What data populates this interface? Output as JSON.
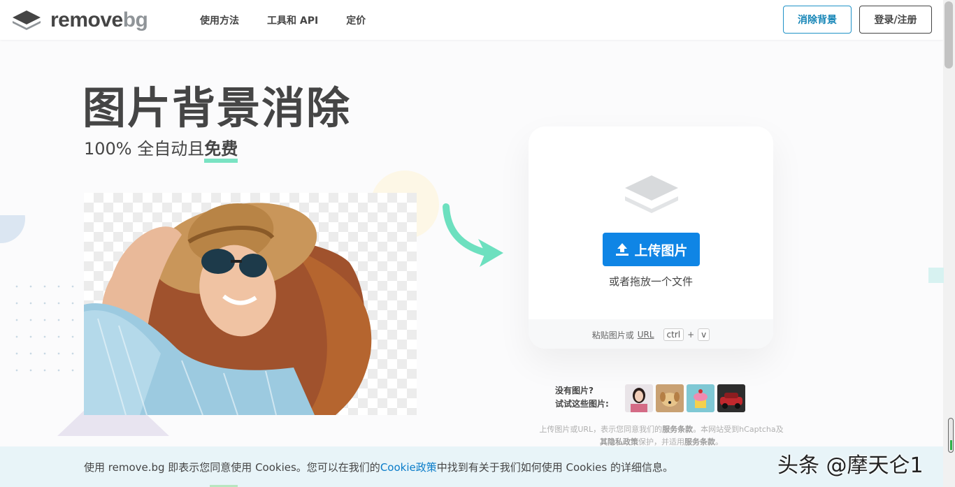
{
  "header": {
    "logo_primary": "remove",
    "logo_secondary": "bg",
    "nav": [
      "使用方法",
      "工具和 API",
      "定价"
    ],
    "remove_bg_button": "消除背景",
    "login_button": "登录/注册"
  },
  "hero": {
    "title": "图片背景消除",
    "subtitle_prefix": "100% 全自动且",
    "subtitle_highlight": "免费"
  },
  "upload_card": {
    "upload_button": "上传图片",
    "drop_text": "或者拖放一个文件",
    "paste_prefix": "粘贴图片或",
    "paste_url": "URL",
    "key_ctrl": "ctrl",
    "plus": "+",
    "key_v": "v"
  },
  "samples": {
    "line1": "没有图片?",
    "line2": "试试这些图片:",
    "icons": [
      "sample-woman-thumb",
      "sample-dog-thumb",
      "sample-cake-thumb",
      "sample-car-thumb"
    ]
  },
  "terms": {
    "t1": "上传图片或URL，表示您同意我们的",
    "t2": "服务条款",
    "t3": "。本网站受到hCaptcha及",
    "t4": "其隐私政策",
    "t5": "保护，并适用",
    "t6": "服务条款",
    "t7": "。"
  },
  "cookie": {
    "prefix": "使用 remove.bg 即表示您同意使用 Cookies。您可以在我们的",
    "link": "Cookie政策",
    "suffix": "中找到有关于我们如何使用 Cookies 的详细信息。"
  },
  "watermark": "头条 @摩天仑1",
  "colors": {
    "accent_blue": "#0f85e5",
    "accent_green": "#7ae3c3",
    "text_dark": "#454545"
  }
}
